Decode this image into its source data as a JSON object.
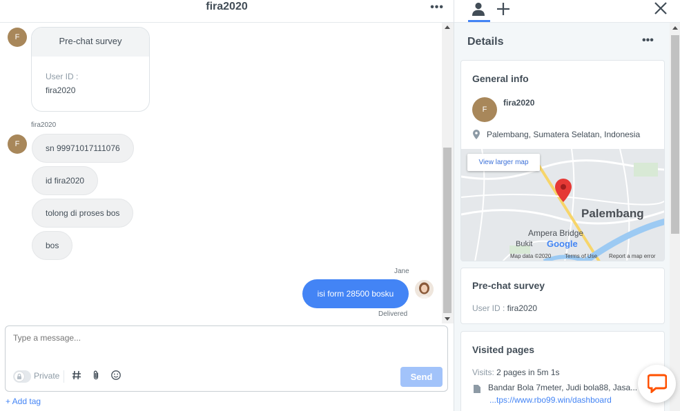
{
  "chat": {
    "title": "fira2020",
    "menu_glyph": "•••",
    "customer_initial": "F",
    "survey_card": {
      "title": "Pre-chat survey",
      "user_id_label": "User ID :",
      "user_id_value": "fira2020"
    },
    "sender_name": "fira2020",
    "incoming": [
      {
        "text": "sn 99971017111076"
      },
      {
        "text": "id fira2020"
      },
      {
        "text": "tolong di proses bos"
      },
      {
        "text": "bos"
      }
    ],
    "agent_name": "Jane",
    "outgoing_text": "isi form 28500 bosku",
    "delivery_status": "Delivered"
  },
  "composer": {
    "placeholder": "Type a message...",
    "private_label": "Private",
    "send_label": "Send",
    "add_tag_label": "+ Add tag"
  },
  "details": {
    "title": "Details",
    "menu_glyph": "•••",
    "close_glyph": "✕",
    "general_info": {
      "title": "General info",
      "initial": "F",
      "name": "fira2020",
      "location": "Palembang, Sumatera Selatan, Indonesia"
    },
    "map": {
      "view_larger_label": "View larger map",
      "city_label": "Palembang",
      "bridge_label": "Ampera Bridge",
      "bukit_label": "Bukit",
      "google_label": "Google",
      "map_data": "Map data ©2020",
      "terms": "Terms of Use",
      "report": "Report a map error"
    },
    "prechat": {
      "title": "Pre-chat survey",
      "user_id_label": "User ID : ",
      "user_id_value": "fira2020"
    },
    "visited": {
      "title": "Visited pages",
      "visits_label": "Visits: ",
      "visits_value": "2 pages in 5m 1s",
      "page_title": "Bandar Bola 7meter, Judi bola88, Jasa...",
      "page_url": "...tps://www.rbo99.win/dashboard"
    }
  },
  "colors": {
    "accent": "#4384f5",
    "send_disabled": "#a2c3fa",
    "customer_avatar": "#a8875a",
    "fab_icon": "#ff5100",
    "map_pin": "#e53935"
  }
}
